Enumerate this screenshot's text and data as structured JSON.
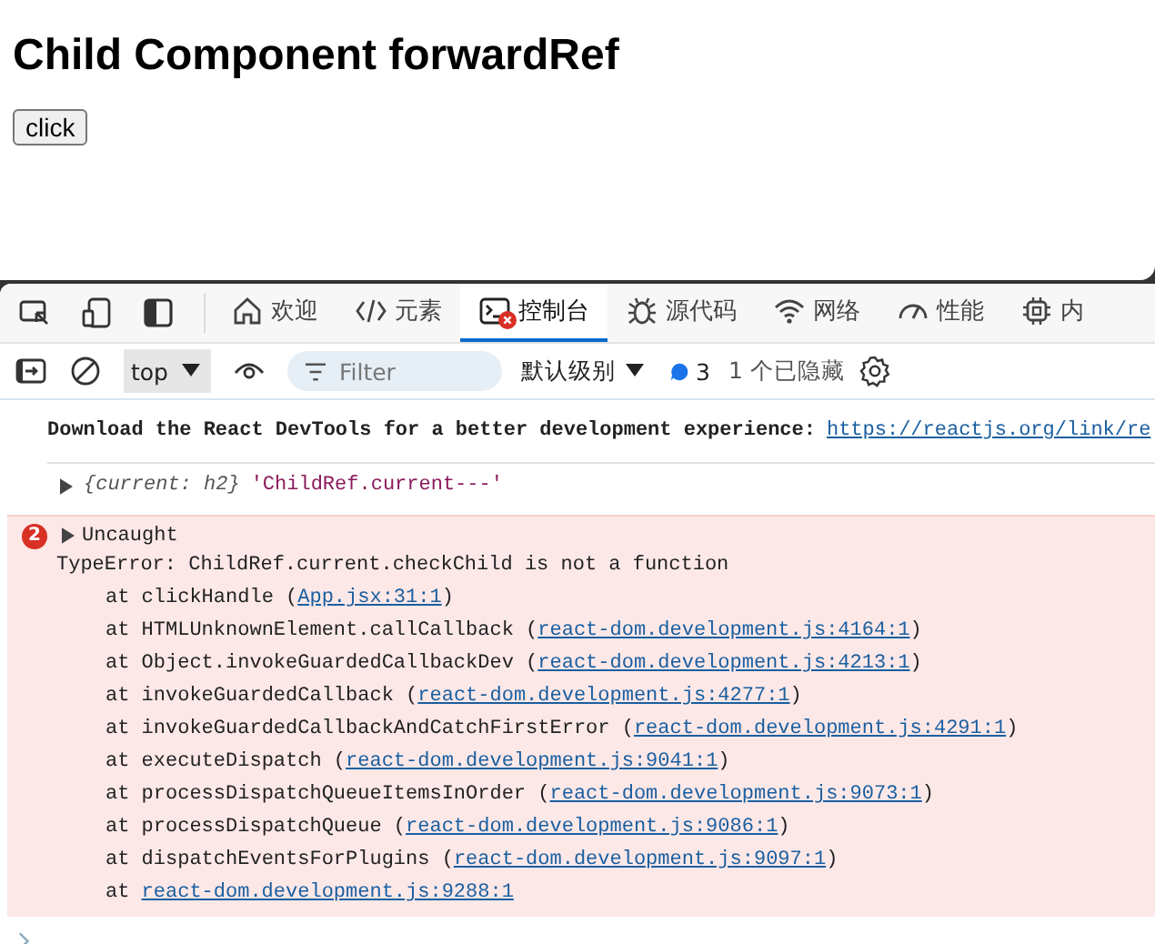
{
  "page": {
    "heading": "Child Component forwardRef",
    "button": "click"
  },
  "devtools": {
    "tabs": [
      {
        "label": "欢迎",
        "selected": false
      },
      {
        "label": "元素",
        "selected": false
      },
      {
        "label": "控制台",
        "selected": true,
        "error_badge": true
      },
      {
        "label": "源代码",
        "selected": false
      },
      {
        "label": "网络",
        "selected": false
      },
      {
        "label": "性能",
        "selected": false
      },
      {
        "label": "内",
        "selected": false
      }
    ],
    "toolbar": {
      "context": "top",
      "filter_placeholder": "Filter",
      "level": "默认级别",
      "message_count": "3",
      "hidden": "1 个已隐藏"
    },
    "console": {
      "info": {
        "text": "Download the React DevTools for a better development experience:",
        "link": "https://reactjs.org/link/re"
      },
      "log": {
        "object": "{current: h2}",
        "string": "'ChildRef.current---'"
      },
      "error": {
        "count": "2",
        "title": "Uncaught",
        "message": "TypeError: ChildRef.current.checkChild is not a function",
        "frames": [
          {
            "text": "at clickHandle (",
            "link": "App.jsx:31:1",
            "close": ")"
          },
          {
            "text": "at HTMLUnknownElement.callCallback (",
            "link": "react-dom.development.js:4164:1",
            "close": ")"
          },
          {
            "text": "at Object.invokeGuardedCallbackDev (",
            "link": "react-dom.development.js:4213:1",
            "close": ")"
          },
          {
            "text": "at invokeGuardedCallback (",
            "link": "react-dom.development.js:4277:1",
            "close": ")"
          },
          {
            "text": "at invokeGuardedCallbackAndCatchFirstError (",
            "link": "react-dom.development.js:4291:1",
            "close": ")"
          },
          {
            "text": "at executeDispatch (",
            "link": "react-dom.development.js:9041:1",
            "close": ")"
          },
          {
            "text": "at processDispatchQueueItemsInOrder (",
            "link": "react-dom.development.js:9073:1",
            "close": ")"
          },
          {
            "text": "at processDispatchQueue (",
            "link": "react-dom.development.js:9086:1",
            "close": ")"
          },
          {
            "text": "at dispatchEventsForPlugins (",
            "link": "react-dom.development.js:9097:1",
            "close": ")"
          },
          {
            "text": "at",
            "link": "react-dom.development.js:9288:1"
          }
        ]
      }
    }
  }
}
